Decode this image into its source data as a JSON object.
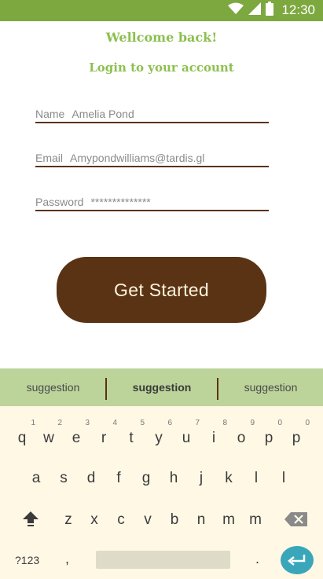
{
  "status_bar": {
    "time": "12:30",
    "icons": [
      "wifi-icon",
      "signal-icon",
      "battery-icon"
    ]
  },
  "login": {
    "welcome": "Wellcome back!",
    "subtitle": "Login to your account",
    "fields": [
      {
        "label": "Name",
        "value": "Amelia Pond"
      },
      {
        "label": "Email",
        "value": "Amypondwilliams@tardis.gl"
      },
      {
        "label": "Password",
        "value": "**************"
      }
    ],
    "button": "Get Started"
  },
  "keyboard": {
    "suggestions": [
      "suggestion",
      "suggestion",
      "suggestion"
    ],
    "row1": [
      {
        "key": "q",
        "hint": "1"
      },
      {
        "key": "w",
        "hint": "2"
      },
      {
        "key": "e",
        "hint": "3"
      },
      {
        "key": "r",
        "hint": "4"
      },
      {
        "key": "t",
        "hint": "5"
      },
      {
        "key": "y",
        "hint": "6"
      },
      {
        "key": "u",
        "hint": "7"
      },
      {
        "key": "i",
        "hint": "8"
      },
      {
        "key": "o",
        "hint": "9"
      },
      {
        "key": "p",
        "hint": "0"
      },
      {
        "key": "p",
        "hint": "0"
      }
    ],
    "row2": [
      "a",
      "s",
      "d",
      "f",
      "g",
      "h",
      "j",
      "k",
      "l",
      "l"
    ],
    "row3": [
      "z",
      "x",
      "c",
      "v",
      "b",
      "n",
      "m",
      "m"
    ],
    "symbols": "?123",
    "comma": ",",
    "period": ".",
    "icons": [
      "shift-icon",
      "backspace-icon",
      "enter-icon"
    ]
  },
  "colors": {
    "brand_green": "#7da83f",
    "title_green": "#8cc04e",
    "brown": "#5a3314",
    "keyboard_bg": "#fef8e5",
    "suggestion_bg": "#bcd49a",
    "enter_teal": "#39a7b9"
  }
}
